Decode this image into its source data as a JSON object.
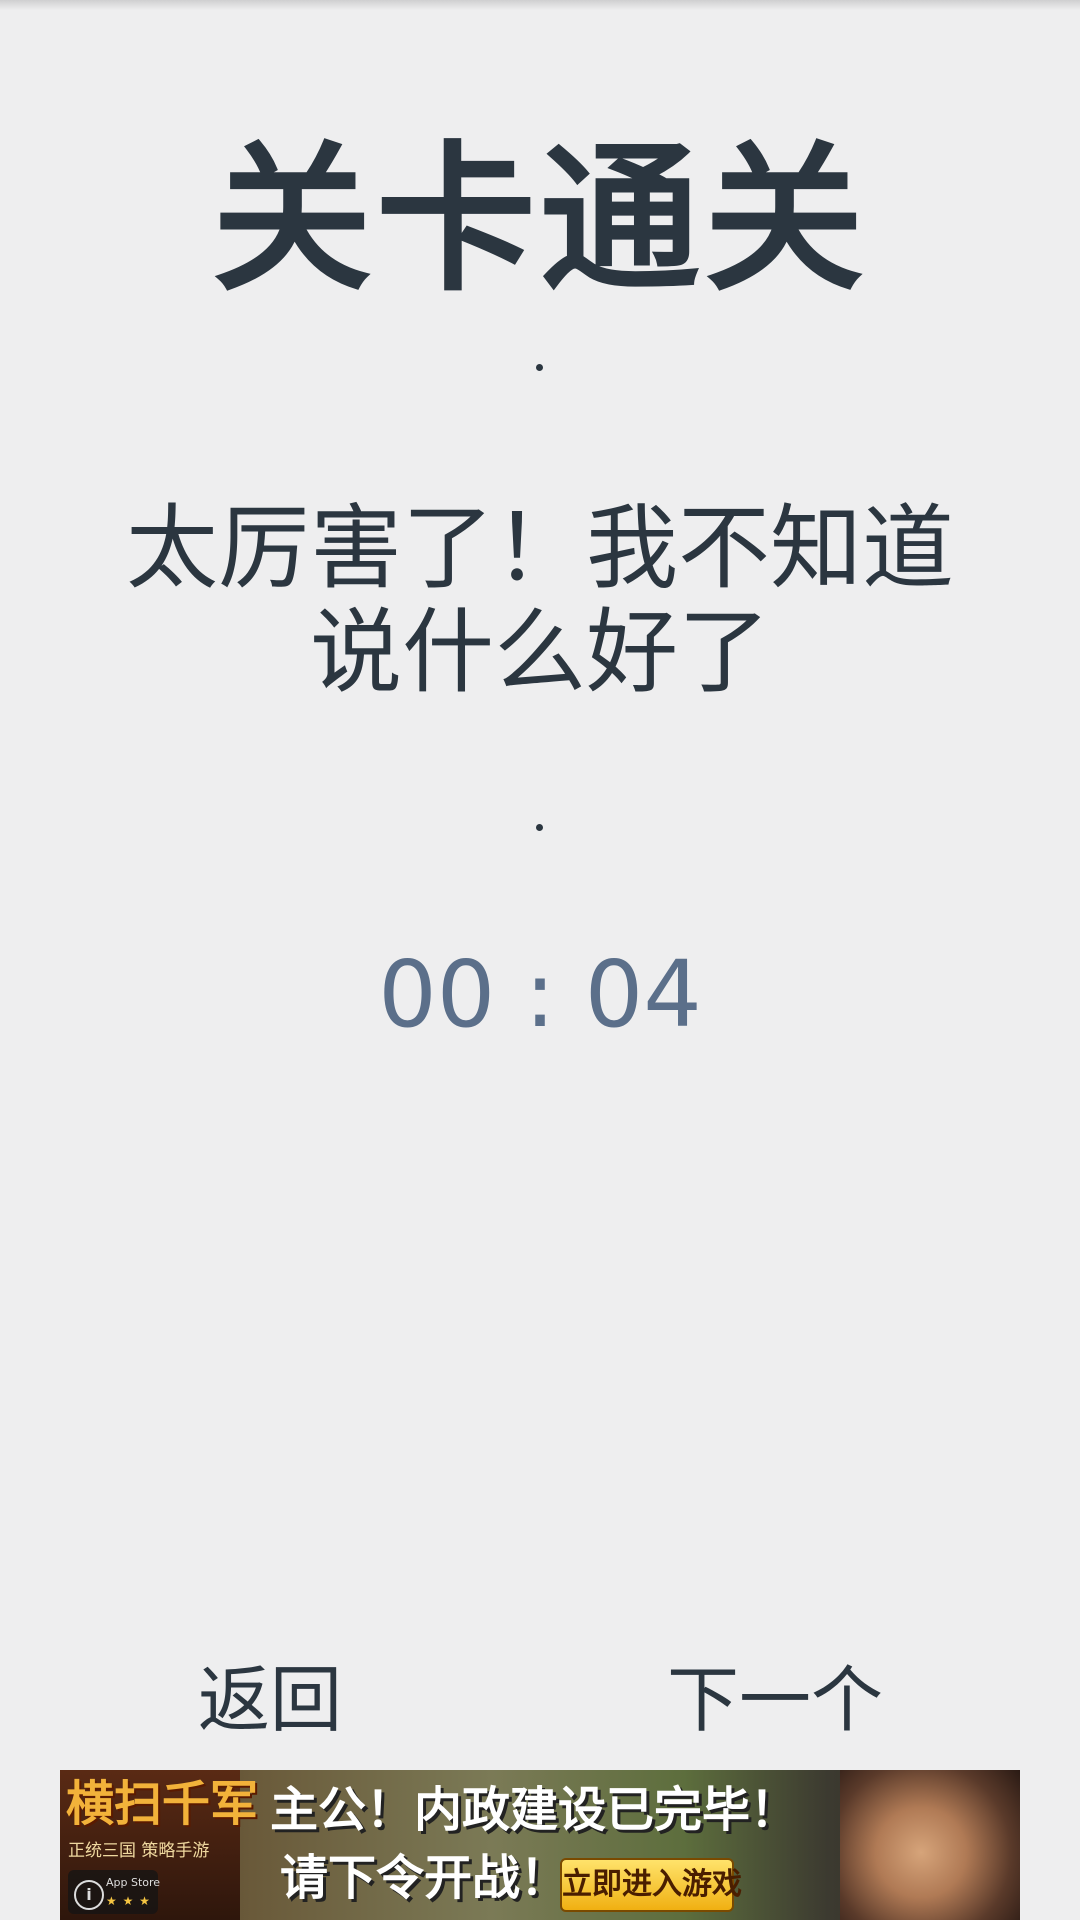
{
  "screen": {
    "title": "关卡通关",
    "message": "太厉害了！我不知道说什么好了",
    "timer": "00 : 04"
  },
  "buttons": {
    "back_label": "返回",
    "next_label": "下一个"
  },
  "ad": {
    "logo_title": "横扫千军",
    "logo_subtitle": "正统三国 策略手游",
    "store_text": "App Store",
    "line1": "主公！内政建设已完毕！",
    "line2": "请下令开战！",
    "cta": "立即进入游戏"
  },
  "colors": {
    "background": "#eeeeef",
    "text": "#2b3640",
    "timer": "#5b6f8a"
  }
}
